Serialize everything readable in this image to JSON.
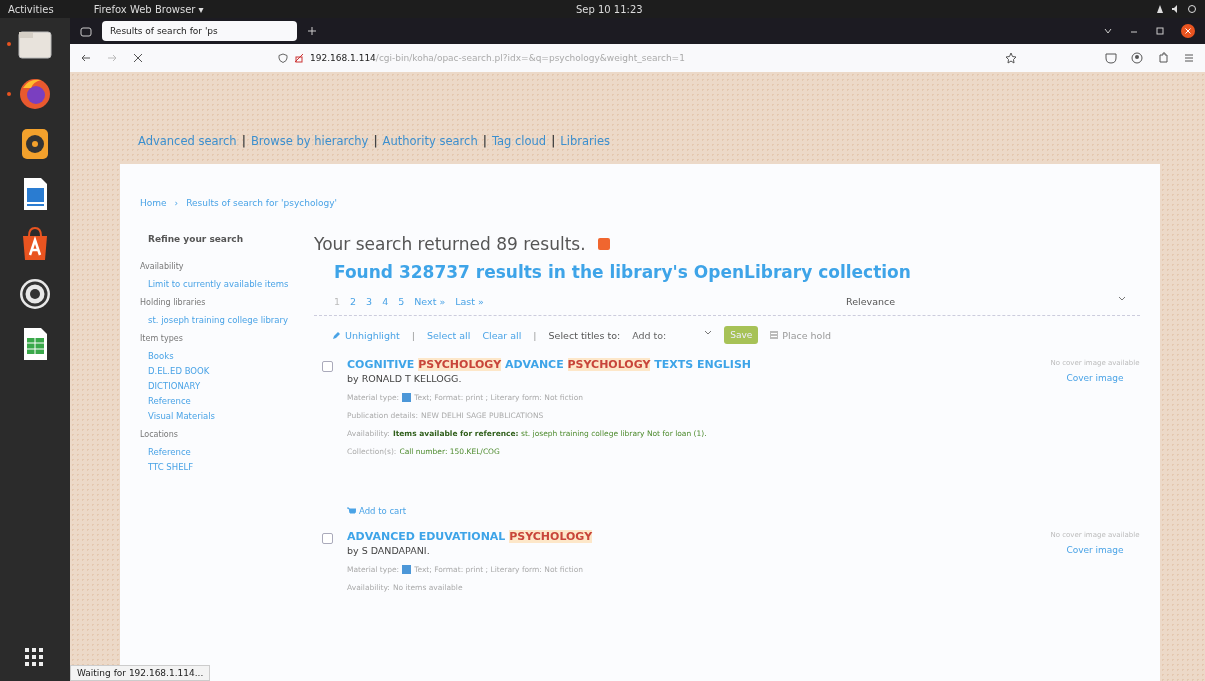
{
  "top_bar": {
    "activities": "Activities",
    "app_menu": "Firefox Web Browser ▾",
    "clock": "Sep 10  11:23"
  },
  "dock": {
    "items": [
      {
        "kind": "files",
        "running": true
      },
      {
        "kind": "firefox",
        "running": true
      },
      {
        "kind": "speaker",
        "running": false
      },
      {
        "kind": "writer",
        "running": false
      },
      {
        "kind": "store",
        "running": false
      },
      {
        "kind": "help",
        "running": false
      },
      {
        "kind": "calc",
        "running": false
      }
    ]
  },
  "browser": {
    "tabs": [
      {
        "label": "Results of search for 'ps",
        "selected": true
      }
    ],
    "address": {
      "host": "192.168.1.114",
      "path": "/cgi-bin/koha/opac-search.pl?idx=&q=psychology&weight_search=1"
    },
    "status": "Waiting for 192.168.1.114..."
  },
  "page": {
    "link_separator": "|",
    "breadcrumb_separator": "›",
    "top_links": [
      "Advanced search",
      "Browse by hierarchy",
      "Authority search",
      "Tag cloud",
      "Libraries"
    ],
    "breadcrumb": [
      "Home",
      "Results of search for 'psychology'"
    ],
    "sidebar": {
      "title": "Refine your search",
      "groups": [
        {
          "heading": "Availability",
          "links": [
            "Limit to currently available items"
          ]
        },
        {
          "heading": "Holding libraries",
          "links": [
            "st. joseph training college library"
          ]
        },
        {
          "heading": "Item types",
          "links": [
            "Books",
            "D.EL.ED BOOK",
            "DICTIONARY",
            "Reference",
            "Visual Materials"
          ]
        },
        {
          "heading": "Locations",
          "links": [
            "Reference",
            "TTC SHELF"
          ]
        }
      ]
    },
    "heading": "Your search returned 89 results.",
    "openlibrary": "Found 328737 results in the library's OpenLibrary collection",
    "pages": [
      {
        "label": "1",
        "selected": true
      },
      {
        "label": "2",
        "selected": false
      },
      {
        "label": "3",
        "selected": false
      },
      {
        "label": "4",
        "selected": false
      },
      {
        "label": "5",
        "selected": false
      },
      {
        "label": "Next »",
        "selected": false
      },
      {
        "label": "Last »",
        "selected": false
      }
    ],
    "sort": "Relevance",
    "toolbar": {
      "separator": "|",
      "unhighlight": "Unhighlight",
      "select_all": "Select all",
      "clear_all": "Clear all",
      "select_titles": "Select titles to:",
      "add_to": "Add to:",
      "save": "Save",
      "place_hold": "Place hold"
    },
    "results": [
      {
        "checked": false,
        "title": [
          {
            "text": "COGNITIVE ",
            "highlighted": false
          },
          {
            "text": "PSYCHOLOGY",
            "highlighted": true
          },
          {
            "text": " ADVANCE ",
            "highlighted": false
          },
          {
            "text": "PSYCHOLOGY",
            "highlighted": true
          },
          {
            "text": " TEXTS ENGLISH",
            "highlighted": false
          }
        ],
        "author": "by RONALD T KELLOGG.",
        "details": [
          {
            "kind": "material",
            "label": "Material type:",
            "value": "Text; Format: print ; Literary form: Not fiction"
          },
          {
            "kind": "plain",
            "label": "Publication details:",
            "value": "NEW DELHI SAGE PUBLICATIONS"
          },
          {
            "kind": "status",
            "label": "Availability:",
            "value": "**Items available for reference:** st. joseph training college library Not for loan (1)."
          },
          {
            "kind": "status",
            "label": "Collection(s):",
            "value": "Call number: 150.KEL/COG"
          }
        ],
        "add_to_cart": "Add to cart",
        "no_cover": "No cover image available",
        "cover_link": "Cover image"
      },
      {
        "checked": false,
        "title": [
          {
            "text": "ADVANCED EDUVATIONAL ",
            "highlighted": false
          },
          {
            "text": "PSYCHOLOGY",
            "highlighted": true
          }
        ],
        "author": "by S DANDAPANI.",
        "details": [
          {
            "kind": "material",
            "label": "Material type:",
            "value": "Text; Format: print ; Literary form: Not fiction"
          },
          {
            "kind": "plain",
            "label": "Availability:",
            "value": "No items available"
          }
        ],
        "no_cover": "No cover image available",
        "cover_link": "Cover image"
      }
    ]
  }
}
